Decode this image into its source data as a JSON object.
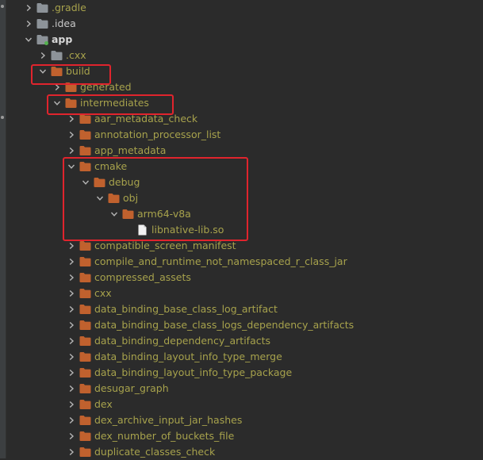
{
  "tree": [
    {
      "depth": 1,
      "expanded": false,
      "kind": "folder-plain",
      "label": ".gradle",
      "style": "excluded"
    },
    {
      "depth": 1,
      "expanded": false,
      "kind": "folder-plain",
      "label": ".idea",
      "style": "plain"
    },
    {
      "depth": 1,
      "expanded": true,
      "kind": "module",
      "label": "app",
      "style": "bold"
    },
    {
      "depth": 2,
      "expanded": false,
      "kind": "folder-plain",
      "label": ".cxx",
      "style": "excluded"
    },
    {
      "depth": 2,
      "expanded": true,
      "kind": "folder",
      "label": "build",
      "style": "excluded"
    },
    {
      "depth": 3,
      "expanded": false,
      "kind": "folder",
      "label": "generated",
      "style": "excluded"
    },
    {
      "depth": 3,
      "expanded": true,
      "kind": "folder",
      "label": "intermediates",
      "style": "excluded"
    },
    {
      "depth": 4,
      "expanded": false,
      "kind": "folder",
      "label": "aar_metadata_check",
      "style": "excluded"
    },
    {
      "depth": 4,
      "expanded": false,
      "kind": "folder",
      "label": "annotation_processor_list",
      "style": "excluded"
    },
    {
      "depth": 4,
      "expanded": false,
      "kind": "folder",
      "label": "app_metadata",
      "style": "excluded"
    },
    {
      "depth": 4,
      "expanded": true,
      "kind": "folder",
      "label": "cmake",
      "style": "excluded"
    },
    {
      "depth": 5,
      "expanded": true,
      "kind": "folder",
      "label": "debug",
      "style": "excluded"
    },
    {
      "depth": 6,
      "expanded": true,
      "kind": "folder",
      "label": "obj",
      "style": "excluded"
    },
    {
      "depth": 7,
      "expanded": true,
      "kind": "folder",
      "label": "arm64-v8a",
      "style": "excluded"
    },
    {
      "depth": 8,
      "expanded": null,
      "kind": "file",
      "label": "libnative-lib.so",
      "style": "excluded"
    },
    {
      "depth": 4,
      "expanded": false,
      "kind": "folder",
      "label": "compatible_screen_manifest",
      "style": "excluded"
    },
    {
      "depth": 4,
      "expanded": false,
      "kind": "folder",
      "label": "compile_and_runtime_not_namespaced_r_class_jar",
      "style": "excluded"
    },
    {
      "depth": 4,
      "expanded": false,
      "kind": "folder",
      "label": "compressed_assets",
      "style": "excluded"
    },
    {
      "depth": 4,
      "expanded": false,
      "kind": "folder",
      "label": "cxx",
      "style": "excluded"
    },
    {
      "depth": 4,
      "expanded": false,
      "kind": "folder",
      "label": "data_binding_base_class_log_artifact",
      "style": "excluded"
    },
    {
      "depth": 4,
      "expanded": false,
      "kind": "folder",
      "label": "data_binding_base_class_logs_dependency_artifacts",
      "style": "excluded"
    },
    {
      "depth": 4,
      "expanded": false,
      "kind": "folder",
      "label": "data_binding_dependency_artifacts",
      "style": "excluded"
    },
    {
      "depth": 4,
      "expanded": false,
      "kind": "folder",
      "label": "data_binding_layout_info_type_merge",
      "style": "excluded"
    },
    {
      "depth": 4,
      "expanded": false,
      "kind": "folder",
      "label": "data_binding_layout_info_type_package",
      "style": "excluded"
    },
    {
      "depth": 4,
      "expanded": false,
      "kind": "folder",
      "label": "desugar_graph",
      "style": "excluded"
    },
    {
      "depth": 4,
      "expanded": false,
      "kind": "folder",
      "label": "dex",
      "style": "excluded"
    },
    {
      "depth": 4,
      "expanded": false,
      "kind": "folder",
      "label": "dex_archive_input_jar_hashes",
      "style": "excluded"
    },
    {
      "depth": 4,
      "expanded": false,
      "kind": "folder",
      "label": "dex_number_of_buckets_file",
      "style": "excluded"
    },
    {
      "depth": 4,
      "expanded": false,
      "kind": "folder",
      "label": "duplicate_classes_check",
      "style": "excluded"
    }
  ],
  "colors": {
    "background": "#2b2b2b",
    "excluded_text": "#a7a24c",
    "plain_text": "#c8c8c8",
    "folder_orange": "#c0612e",
    "folder_grey": "#8d9399",
    "highlight_red": "#e0242d"
  },
  "icons": {
    "folder": "folder-icon",
    "module": "module-folder-icon",
    "file": "file-icon",
    "expanded": "chevron-down-icon",
    "collapsed": "chevron-right-icon"
  }
}
